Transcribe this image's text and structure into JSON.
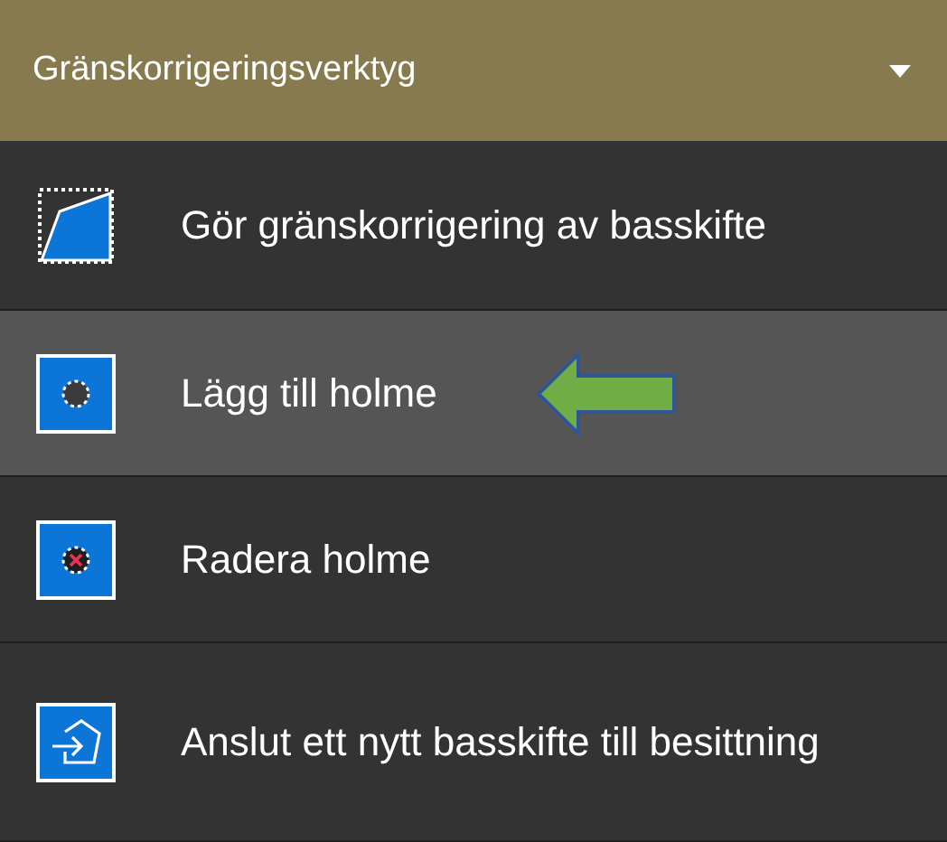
{
  "header": {
    "title": "Gränskorrigeringsverktyg",
    "expanded": true
  },
  "items": [
    {
      "label": "Gör gränskorrigering av basskifte",
      "selected": false,
      "marked": false
    },
    {
      "label": "Lägg till holme",
      "selected": true,
      "marked": true
    },
    {
      "label": "Radera holme",
      "selected": false,
      "marked": false
    },
    {
      "label": "Anslut ett nytt basskifte till besittning",
      "selected": false,
      "marked": false
    }
  ]
}
